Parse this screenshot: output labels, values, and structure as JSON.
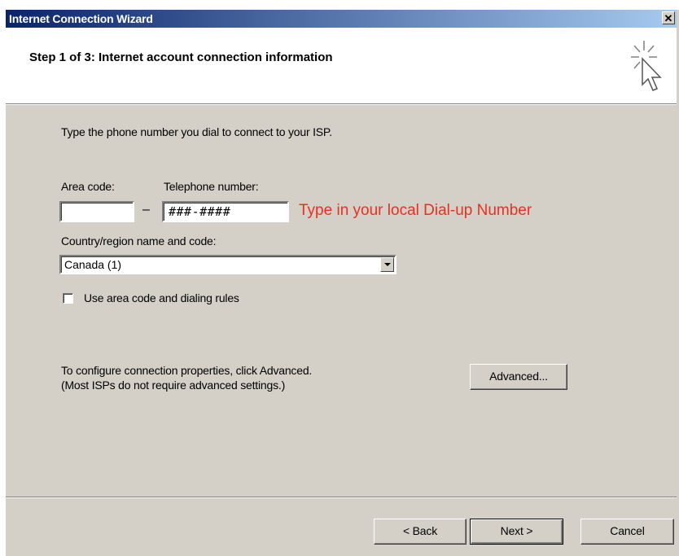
{
  "window": {
    "title": "Internet Connection Wizard",
    "close_glyph": "✕"
  },
  "header": {
    "step_title": "Step 1 of 3: Internet account connection information",
    "icon": "cursor-sparkle-icon"
  },
  "body": {
    "instruction": "Type the phone number you dial to connect to your ISP.",
    "area_code_label": "Area code:",
    "area_code_value": "",
    "dash": "–",
    "telephone_label": "Telephone number:",
    "telephone_value": "###-####",
    "hint": "Type in your local Dial-up Number",
    "country_label": "Country/region name and code:",
    "country_value": "Canada (1)",
    "checkbox_label": "Use area code and dialing rules",
    "checkbox_checked": false,
    "advanced_line1": "To configure connection properties, click Advanced.",
    "advanced_line2": "(Most ISPs do not require advanced settings.)",
    "advanced_button": "Advanced..."
  },
  "footer": {
    "back_button": "< Back",
    "next_button": "Next >",
    "cancel_button": "Cancel"
  },
  "colors": {
    "title_gradient_start": "#0a246a",
    "title_gradient_end": "#a6caf0",
    "dialog_face": "#d4d0c8",
    "hint_red": "#e8301e"
  }
}
